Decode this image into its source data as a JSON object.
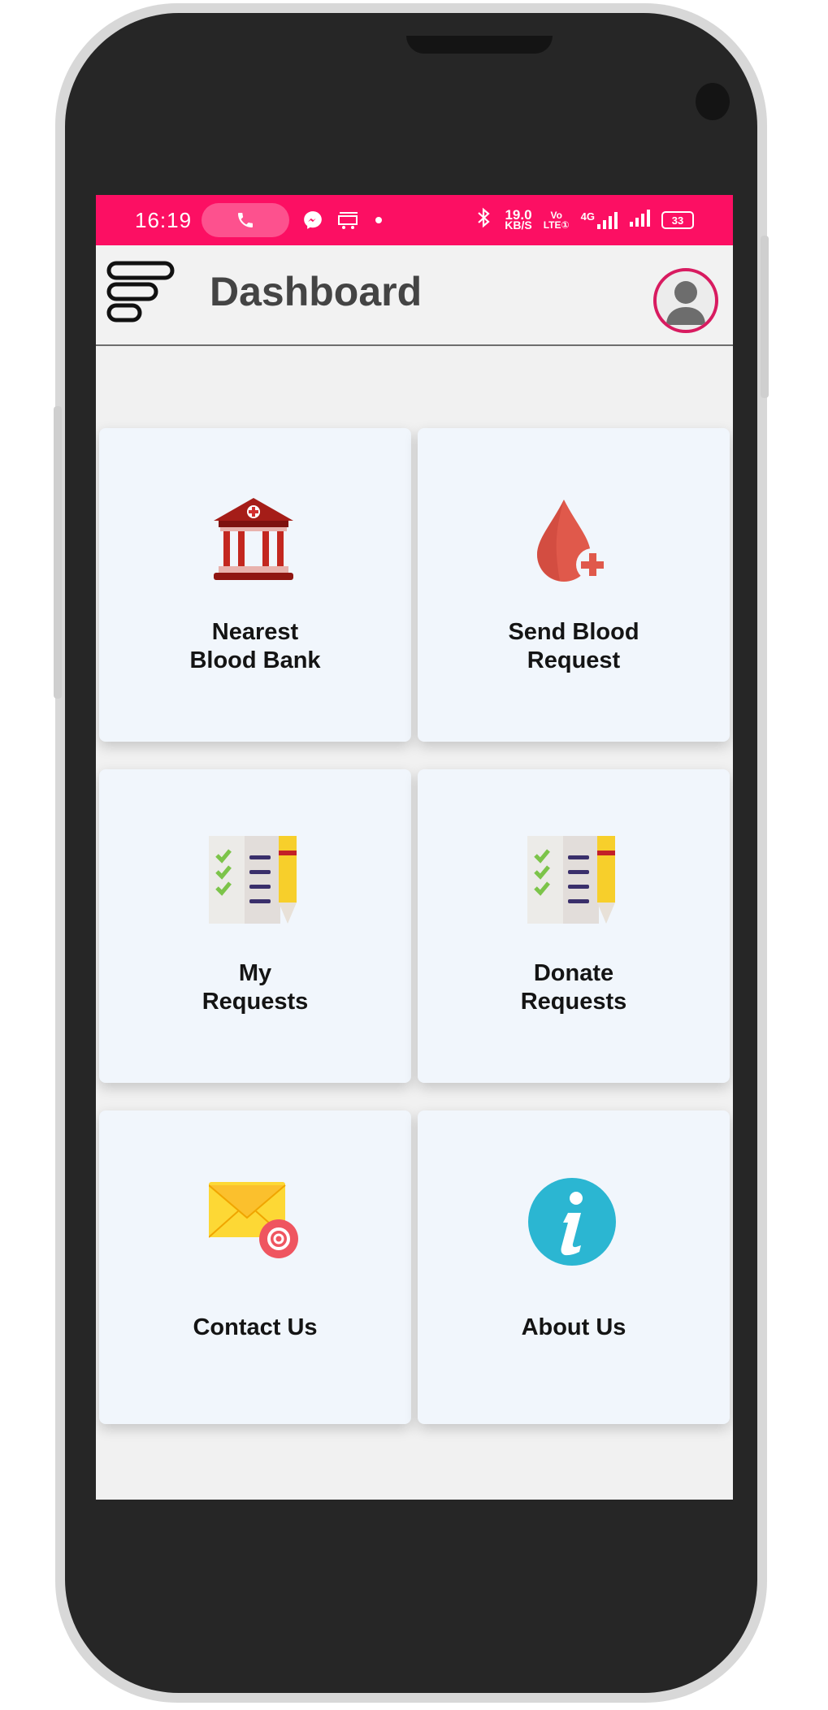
{
  "status_bar": {
    "time": "16:19",
    "speed_value": "19.0",
    "speed_unit": "KB/S",
    "volte_top": "Vo",
    "volte_bottom": "LTE①",
    "network": "4G",
    "battery": "33",
    "notification_icons": [
      "phone-icon",
      "messenger-icon",
      "amazon-icon",
      "dot-icon"
    ],
    "status_icons": [
      "bluetooth-icon",
      "signal-icon",
      "signal-icon"
    ],
    "background_color": "#fc0f63"
  },
  "app_bar": {
    "title": "Dashboard",
    "menu_icon": "menu-icon",
    "profile_icon": "avatar-icon"
  },
  "cards": [
    {
      "line1": "Nearest",
      "line2": "Blood Bank",
      "icon": "bank-icon"
    },
    {
      "line1": "Send Blood",
      "line2": "Request",
      "icon": "blood-drop-icon"
    },
    {
      "line1": "My",
      "line2": "Requests",
      "icon": "checklist-icon"
    },
    {
      "line1": "Donate",
      "line2": "Requests",
      "icon": "checklist-icon"
    },
    {
      "line1": "Contact Us",
      "line2": "",
      "icon": "mail-icon"
    },
    {
      "line1": "About Us",
      "line2": "",
      "icon": "info-icon"
    }
  ],
  "colors": {
    "accent": "#fc0f63",
    "card_background": "#f1f6fc",
    "avatar_ring": "#d81b60"
  }
}
